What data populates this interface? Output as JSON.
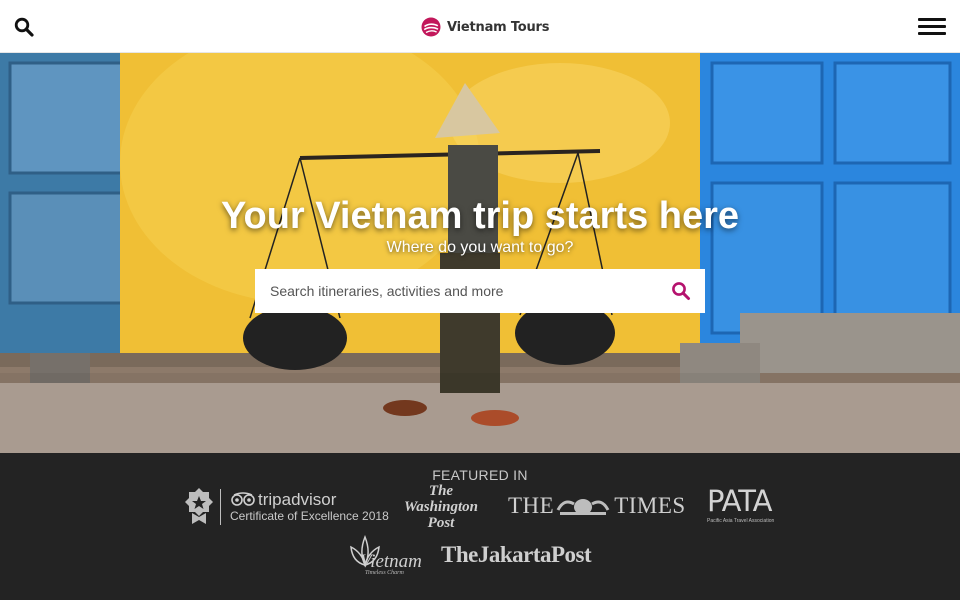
{
  "header": {
    "brand_name": "Vietnam Tours",
    "brand_icon": "vietnam-tours-logo",
    "search_icon": "search-icon",
    "menu_icon": "hamburger-menu-icon"
  },
  "hero": {
    "title": "Your Vietnam trip starts here",
    "subtitle": "Where do you want to go?",
    "search": {
      "placeholder": "Search itineraries, activities and more",
      "value": "",
      "icon": "search-icon"
    }
  },
  "featured": {
    "label": "FEATURED IN",
    "logos": {
      "tripadvisor": {
        "name": "tripadvisor",
        "caption": "Certificate of Excellence 2018"
      },
      "washington_post": {
        "line1": "The",
        "line2": "Washington",
        "line3": "Post"
      },
      "the_times": {
        "left": "THE",
        "right": "TIMES"
      },
      "pata": {
        "name": "PATA",
        "caption": "Pacific Asia Travel Association"
      },
      "vietnam": {
        "name": "Vietnam",
        "tagline": "Timeless Charm"
      },
      "jakarta_post": {
        "name": "TheJakartaPost"
      }
    }
  },
  "colors": {
    "brand_accent": "#c2185b",
    "search_icon_accent": "#b5126e",
    "footer_background": "#232323"
  }
}
